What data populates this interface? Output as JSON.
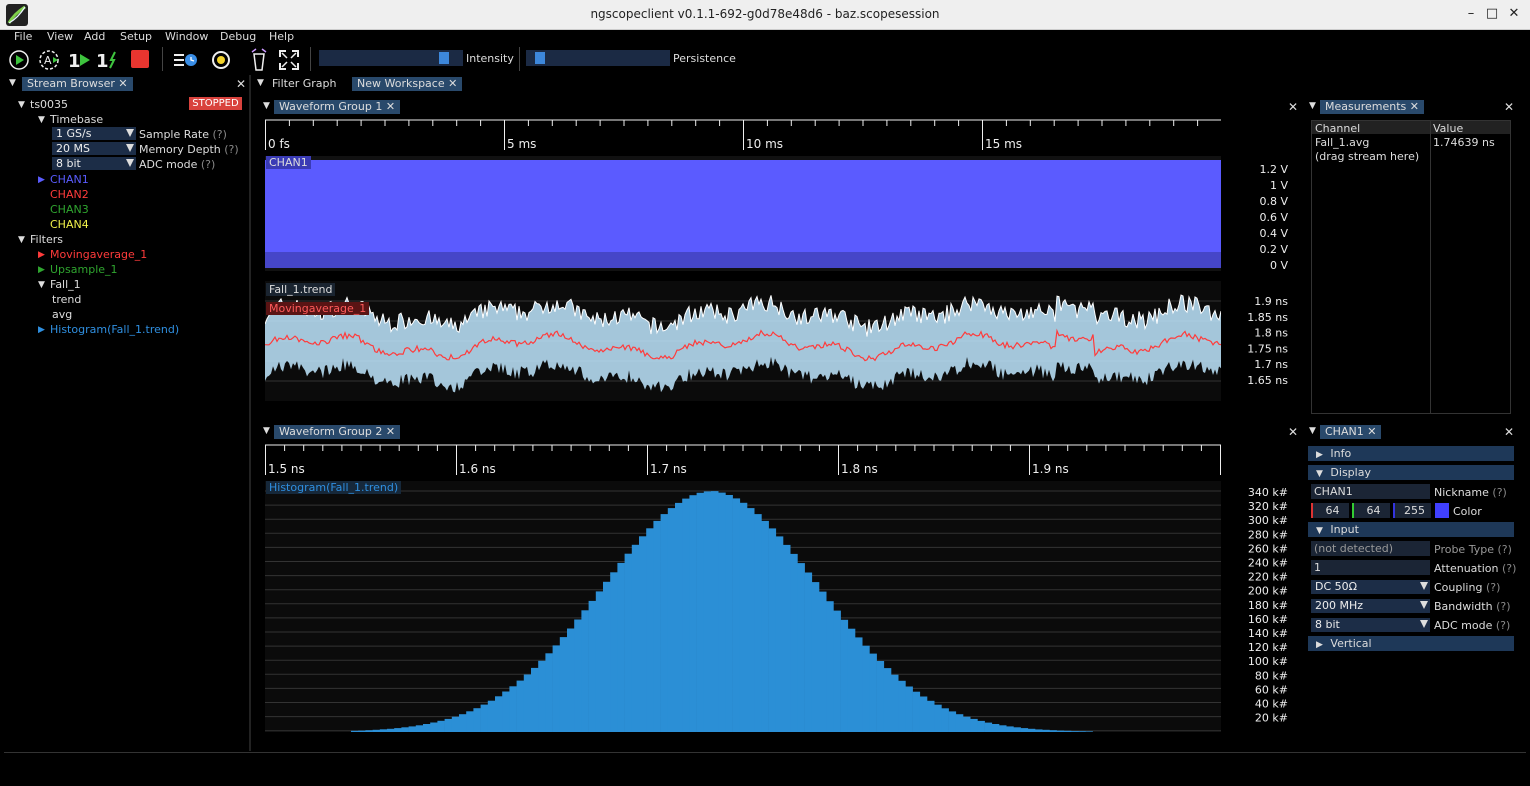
{
  "window": {
    "title": "ngscopeclient v0.1.1-692-g0d78e48d6 - baz.scopesession"
  },
  "menu": [
    "File",
    "View",
    "Add",
    "Setup",
    "Window",
    "Debug",
    "Help"
  ],
  "toolbar": {
    "intensity_label": "Intensity",
    "persistence_label": "Persistence",
    "intensity_level": 0.92,
    "persistence_level": 0.05
  },
  "stream_browser": {
    "tab": "Stream Browser",
    "instrument": "ts0035",
    "status": "STOPPED",
    "timebase_label": "Timebase",
    "sample_rate": {
      "value": "1 GS/s",
      "label": "Sample Rate"
    },
    "memory_depth": {
      "value": "20 MS",
      "label": "Memory Depth"
    },
    "adc_mode": {
      "value": "8 bit",
      "label": "ADC mode"
    },
    "help": "(?)",
    "channels": [
      {
        "name": "CHAN1",
        "color": "#5a5cff"
      },
      {
        "name": "CHAN2",
        "color": "#ff3b3b"
      },
      {
        "name": "CHAN3",
        "color": "#2fa52f"
      },
      {
        "name": "CHAN4",
        "color": "#f2f24a"
      }
    ],
    "filters_label": "Filters",
    "filters": [
      {
        "name": "Movingaverage_1",
        "color": "#ff3b3b"
      },
      {
        "name": "Upsample_1",
        "color": "#2fa52f"
      },
      {
        "name": "Fall_1",
        "color": "#dddddd"
      }
    ],
    "fall_children": [
      "trend",
      "avg"
    ],
    "histogram": {
      "name": "Histogram(Fall_1.trend)",
      "color": "#2f8fe0"
    }
  },
  "tabs": {
    "filter_graph": "Filter Graph",
    "new_workspace": "New Workspace"
  },
  "group1": {
    "tab": "Waveform Group 1",
    "ticks": [
      "0 fs",
      "5 ms",
      "10 ms",
      "15 ms"
    ],
    "chan1_label": "CHAN1",
    "chan1_axis": [
      "1.2 V",
      "1 V",
      "0.8 V",
      "0.6 V",
      "0.4 V",
      "0.2 V",
      "0 V"
    ],
    "trend_label": "Fall_1.trend",
    "mavg_label": "Movingaverage_1",
    "trend_axis": [
      "1.9 ns",
      "1.85 ns",
      "1.8 ns",
      "1.75 ns",
      "1.7 ns",
      "1.65 ns"
    ]
  },
  "group2": {
    "tab": "Waveform Group 2",
    "ticks": [
      "1.5 ns",
      "1.6 ns",
      "1.7 ns",
      "1.8 ns",
      "1.9 ns"
    ],
    "hist_label": "Histogram(Fall_1.trend)",
    "axis": [
      "340 k#",
      "320 k#",
      "300 k#",
      "280 k#",
      "260 k#",
      "240 k#",
      "220 k#",
      "200 k#",
      "180 k#",
      "160 k#",
      "140 k#",
      "120 k#",
      "100 k#",
      "80 k#",
      "60 k#",
      "40 k#",
      "20 k#"
    ]
  },
  "measurements": {
    "tab": "Measurements",
    "col_channel": "Channel",
    "col_value": "Value",
    "rows": [
      {
        "channel": "Fall_1.avg",
        "value": "1.74639 ns"
      },
      {
        "channel": "(drag stream here)",
        "value": ""
      }
    ]
  },
  "chan_props": {
    "tab": "CHAN1",
    "info": "Info",
    "display": "Display",
    "nickname_value": "CHAN1",
    "nickname_label": "Nickname",
    "r": "64",
    "g": "64",
    "b": "255",
    "color_label": "Color",
    "swatch": "#4040ff",
    "input": "Input",
    "probe_value": "(not detected)",
    "probe_label": "Probe Type",
    "atten_value": "1",
    "atten_label": "Attenuation",
    "coupling_value": "DC 50Ω",
    "coupling_label": "Coupling",
    "bw_value": "200 MHz",
    "bw_label": "Bandwidth",
    "adc_value": "8 bit",
    "adc_label": "ADC mode",
    "vertical": "Vertical",
    "help": "(?)"
  }
}
